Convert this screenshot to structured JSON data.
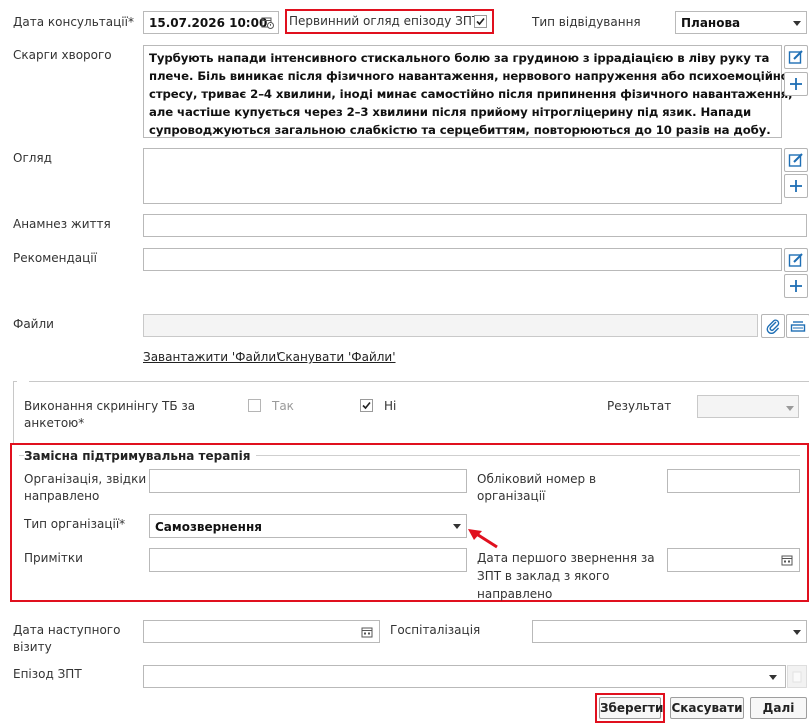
{
  "consult": {
    "date_label": "Дата консультації*",
    "date_value": "15.07.2026 10:00",
    "primary_exam_label": "Первинний огляд епізоду ЗПТ",
    "visit_type_label": "Тип відвідування",
    "visit_type_value": "Планова"
  },
  "complaints": {
    "label": "Скарги хворого",
    "lines": [
      "Турбують напади інтенсивного стискального болю за грудиною з іррадіацією в ліву руку та",
      "плече. Біль виникає після фізичного навантаження, нервового напруження або психоемоційного",
      "стресу, триває 2–4 хвилини, іноді минає самостійно після припинення фізичного навантаження,",
      "але частіше купується через 2–3 хвилини після прийому нітрогліцерину під язик. Напади",
      "супроводжуються загальною слабкістю та серцебиттям, повторюються до 10 разів на добу."
    ]
  },
  "exam": {
    "label": "Огляд"
  },
  "anamnesis": {
    "label": "Анамнез життя"
  },
  "recommendations": {
    "label": "Рекомендації"
  },
  "files": {
    "label": "Файли",
    "upload_link": "Завантажити 'Файли'",
    "scan_link": "Сканувати 'Файли'"
  },
  "tb_screening": {
    "label_line1": "Виконання скринінгу ТБ за",
    "label_line2": "анкетою*",
    "yes_label": "Так",
    "no_label": "Ні",
    "result_label": "Результат"
  },
  "substitution": {
    "title": "Замісна підтримувальна терапія",
    "org_label_line1": "Організація, звідки",
    "org_label_line2": "направлено",
    "account_label_line1": "Обліковий номер в",
    "account_label_line2": "організації",
    "org_type_label": "Тип організації*",
    "org_type_value": "Самозвернення",
    "notes_label": "Примітки",
    "first_visit_label_line1": "Дата першого звернення за",
    "first_visit_label_line2": "ЗПТ в заклад з якого",
    "first_visit_label_line3": "направлено"
  },
  "next_visit": {
    "label_line1": "Дата наступного",
    "label_line2": "візиту"
  },
  "hospitalization": {
    "label": "Госпіталізація"
  },
  "episode": {
    "label": "Епізод ЗПТ"
  },
  "actions": {
    "save": "Зберегти",
    "cancel": "Скасувати",
    "next": "Далі"
  },
  "colors": {
    "highlight": "#e0101e",
    "border": "#b9b9b9"
  }
}
